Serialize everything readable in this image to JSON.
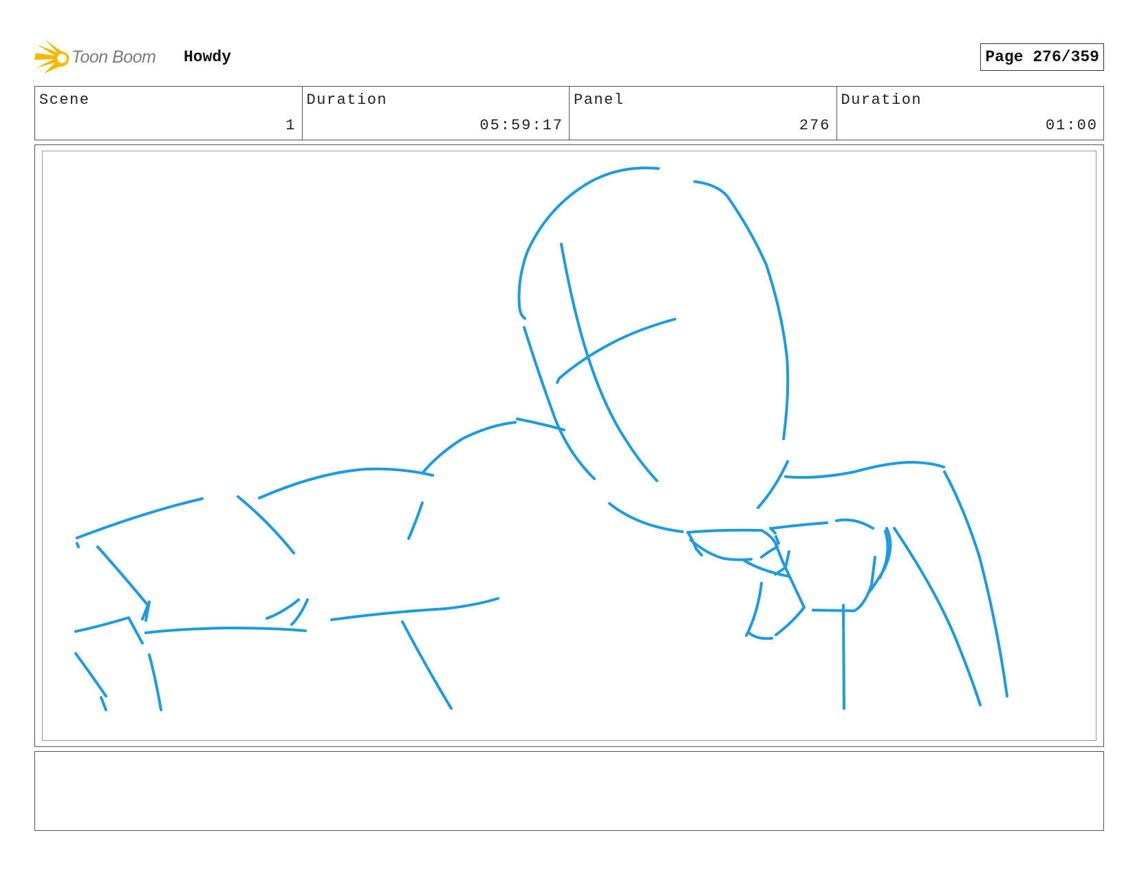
{
  "header": {
    "logo_text": "Toon Boom",
    "project_title": "Howdy",
    "page_label": "Page 276/359"
  },
  "info": {
    "scene_label": "Scene",
    "scene_value": "1",
    "scene_duration_label": "Duration",
    "scene_duration_value": "05:59:17",
    "panel_label": "Panel",
    "panel_value": "276",
    "panel_duration_label": "Duration",
    "panel_duration_value": "01:00"
  },
  "colors": {
    "sketch_stroke": "#1e9be0",
    "logo_flame": "#f5b800"
  },
  "notes": {
    "text": ""
  }
}
